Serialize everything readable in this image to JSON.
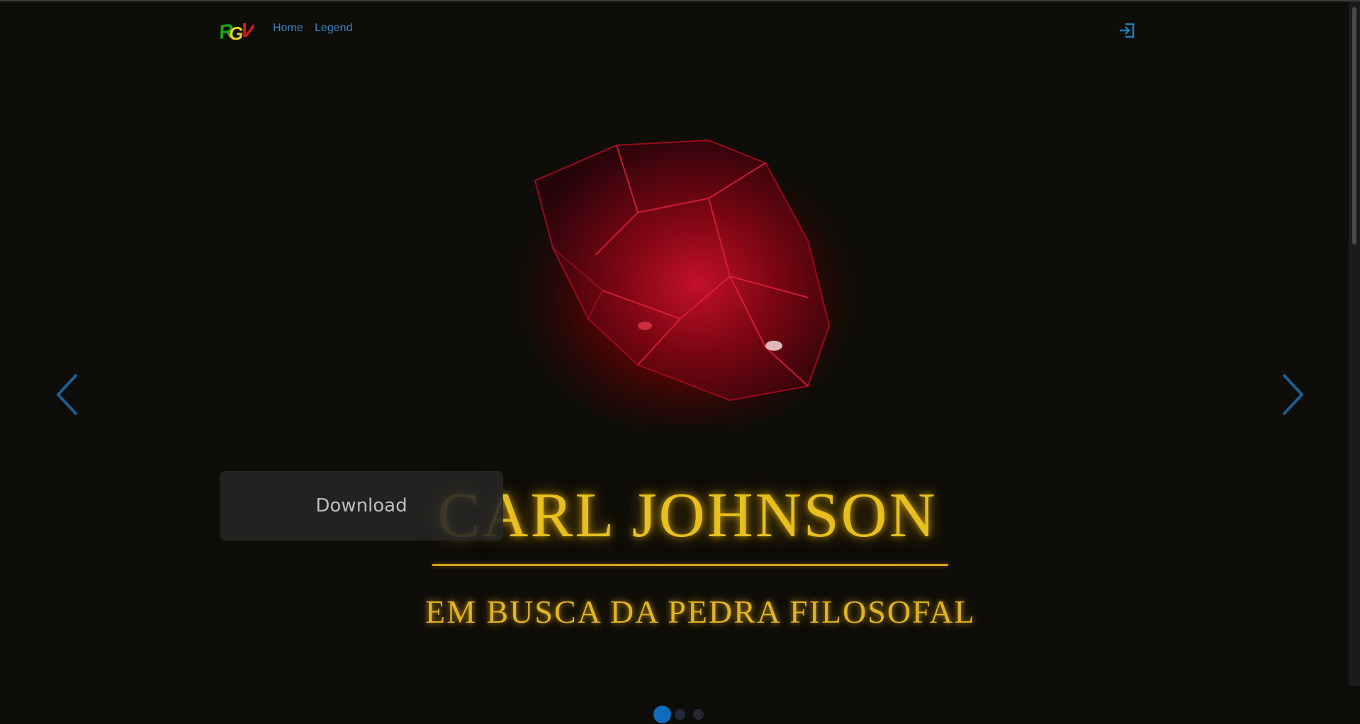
{
  "nav": {
    "logo_text": "RGV",
    "links": [
      {
        "label": "Home"
      },
      {
        "label": "Legend"
      }
    ],
    "login_icon": "login-icon"
  },
  "slide": {
    "title": "CARL JOHNSON",
    "subtitle": "EM BUSCA DA PEDRA FILOSOFAL",
    "download_label": "Download",
    "image_icon": "red-stone"
  },
  "carousel": {
    "prev_icon": "chevron-left-icon",
    "next_icon": "chevron-right-icon",
    "slide_count": 3,
    "active_index": 0
  },
  "colors": {
    "background": "#0e0d09",
    "link": "#3f83c9",
    "gold": "#e7bf1e",
    "accent_blue": "#0f6cbd"
  }
}
